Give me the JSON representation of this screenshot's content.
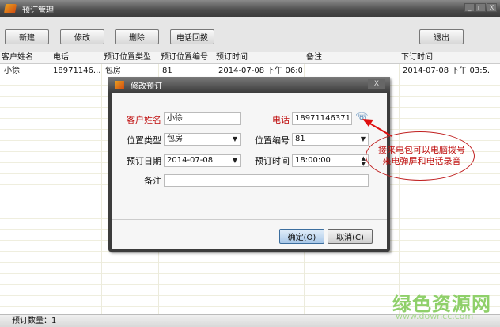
{
  "window": {
    "title": "预订管理",
    "controls": [
      "_",
      "□",
      "X"
    ]
  },
  "toolbar": {
    "new": "新建",
    "edit": "修改",
    "delete": "删除",
    "callback": "电话回拨",
    "exit": "退出"
  },
  "table": {
    "columns": [
      "客户姓名",
      "电话",
      "预订位置类型",
      "预订位置编号",
      "预订时间",
      "备注",
      "下订时间"
    ],
    "rows": [
      [
        "小徐",
        "18971146...",
        "包房",
        "81",
        "2014-07-08 下午 06:0...",
        "",
        "2014-07-08 下午 03:5..."
      ]
    ]
  },
  "status": {
    "label": "预订数量：",
    "count": "1"
  },
  "dialog": {
    "title": "修改预订",
    "close": "X",
    "name_label": "客户姓名",
    "name": "小徐",
    "phone_label": "电话",
    "phone": "18971146371",
    "type_label": "位置类型",
    "type": "包房",
    "number_label": "位置编号",
    "number": "81",
    "date_label": "预订日期",
    "date": "2014-07-08",
    "time_label": "预订时间",
    "time": "18:00:00",
    "note_label": "备注",
    "note": "",
    "ok": "确定(O)",
    "cancel": "取消(C)"
  },
  "annotation": {
    "line1": "接来电包可以电脑拨号",
    "line2": "来电弹屏和电话录音"
  },
  "watermark": {
    "title": "绿色资源网",
    "url": "www.downcc.com"
  }
}
